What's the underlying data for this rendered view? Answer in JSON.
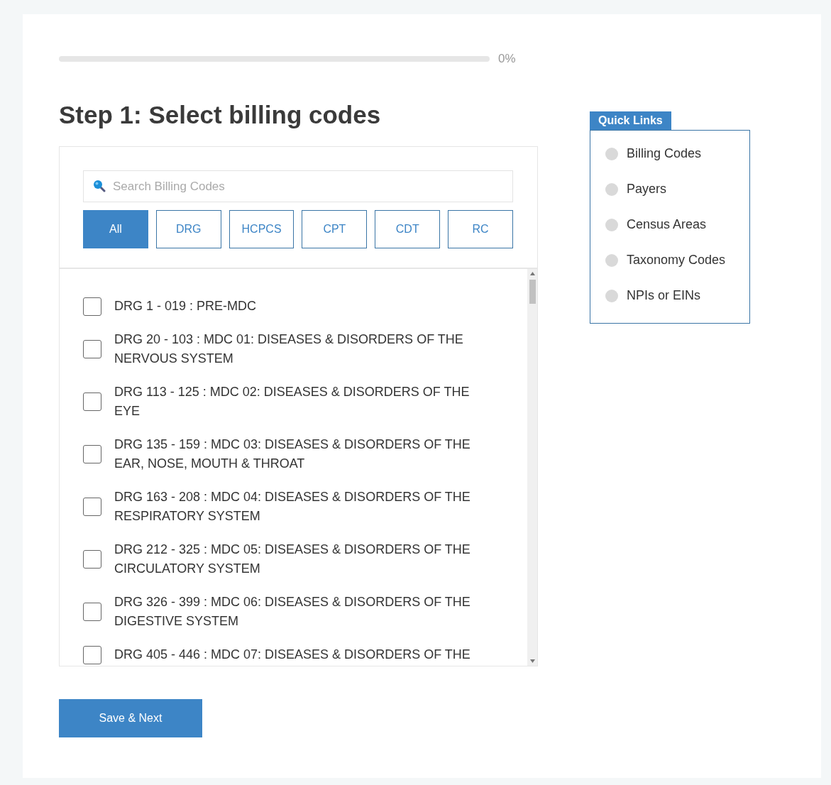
{
  "progress": {
    "level": 0,
    "label": "0%"
  },
  "title": "Step 1: Select billing codes",
  "search": {
    "placeholder": "Search Billing Codes"
  },
  "filters": [
    {
      "label": "All",
      "selected": true
    },
    {
      "label": "DRG",
      "selected": false
    },
    {
      "label": "HCPCS",
      "selected": false
    },
    {
      "label": "CPT",
      "selected": false
    },
    {
      "label": "CDT",
      "selected": false
    },
    {
      "label": "RC",
      "selected": false
    }
  ],
  "codes": [
    {
      "label": "DRG 1 - 019 : PRE-MDC",
      "checked": false
    },
    {
      "label": "DRG 20 - 103 : MDC 01: DISEASES & DISORDERS OF THE NERVOUS SYSTEM",
      "checked": false
    },
    {
      "label": "DRG 113 - 125 : MDC 02: DISEASES & DISORDERS OF THE EYE",
      "checked": false
    },
    {
      "label": "DRG 135 - 159 : MDC 03: DISEASES & DISORDERS OF THE EAR, NOSE, MOUTH & THROAT",
      "checked": false
    },
    {
      "label": "DRG 163 - 208 : MDC 04: DISEASES & DISORDERS OF THE RESPIRATORY SYSTEM",
      "checked": false
    },
    {
      "label": "DRG 212 - 325 : MDC 05: DISEASES & DISORDERS OF THE CIRCULATORY SYSTEM",
      "checked": false
    },
    {
      "label": "DRG 326 - 399 : MDC 06: DISEASES & DISORDERS OF THE DIGESTIVE SYSTEM",
      "checked": false
    },
    {
      "label": "DRG 405 - 446 : MDC 07: DISEASES & DISORDERS OF THE",
      "checked": false
    }
  ],
  "save_button": "Save & Next",
  "quick_links": {
    "title": "Quick Links",
    "items": [
      {
        "label": "Billing Codes",
        "selected": false
      },
      {
        "label": "Payers",
        "selected": false
      },
      {
        "label": "Census Areas",
        "selected": false
      },
      {
        "label": "Taxonomy Codes",
        "selected": false
      },
      {
        "label": "NPIs or EINs",
        "selected": false
      }
    ]
  }
}
